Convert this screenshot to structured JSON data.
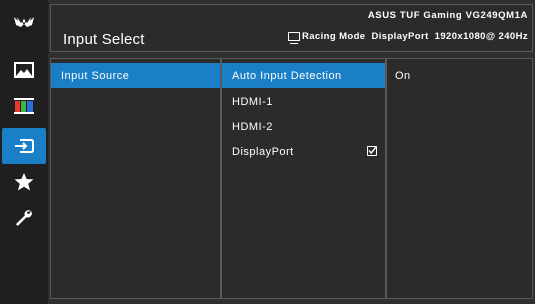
{
  "header": {
    "title": "Input Select",
    "model": "ASUS TUF Gaming  VG249QM1A",
    "mode": "Racing Mode",
    "port": "DisplayPort",
    "resolution": "1920x1080@ 240Hz"
  },
  "sidebar": {
    "items": [
      {
        "icon": "tuf-logo-icon"
      },
      {
        "icon": "picture-icon"
      },
      {
        "icon": "color-bars-icon"
      },
      {
        "icon": "input-select-icon",
        "active": true
      },
      {
        "icon": "star-icon"
      },
      {
        "icon": "wrench-icon"
      }
    ]
  },
  "menu": {
    "level1": [
      {
        "label": "Input Source",
        "selected": true
      }
    ],
    "level2": [
      {
        "label": "Auto Input Detection",
        "selected": true
      },
      {
        "label": "HDMI-1"
      },
      {
        "label": "HDMI-2"
      },
      {
        "label": "DisplayPort",
        "checked": true
      }
    ],
    "level3": [
      {
        "label": "On"
      }
    ]
  },
  "colors": {
    "accent": "#1a7fc6",
    "background": "#2f2f2f",
    "panel": "#2b2b2b",
    "border": "#5a5a5a"
  }
}
